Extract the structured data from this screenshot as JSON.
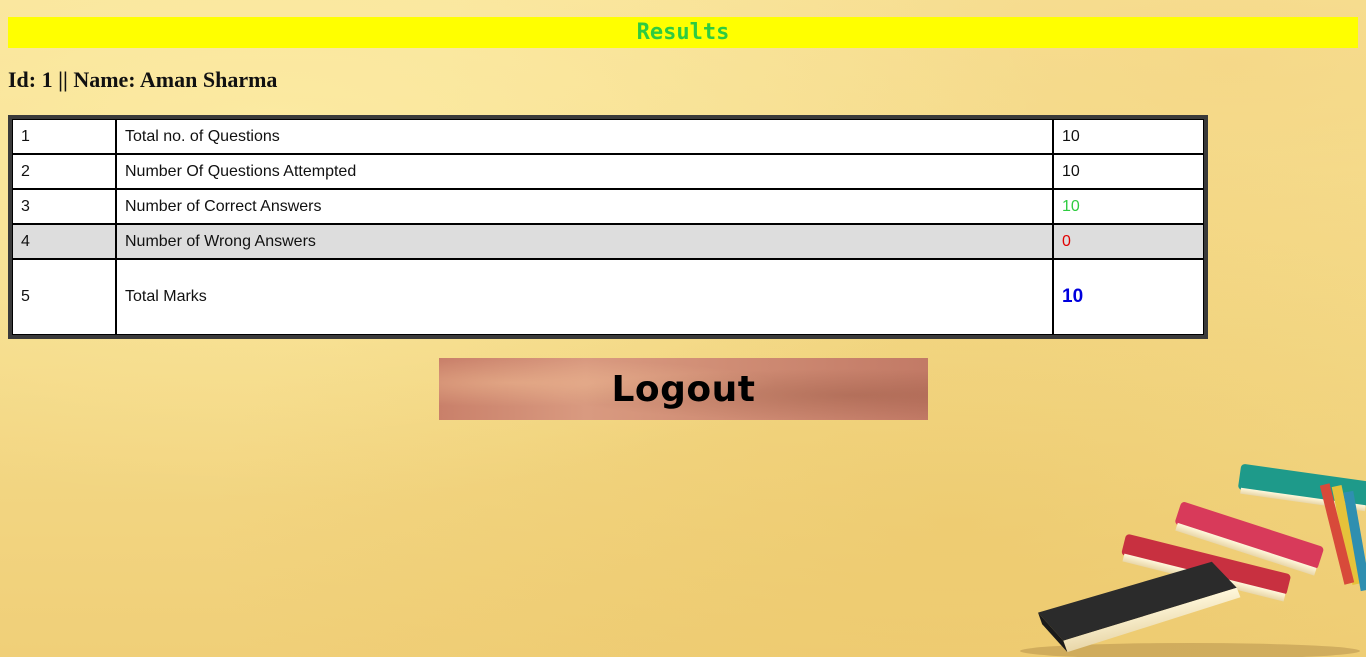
{
  "header": {
    "title": "Results"
  },
  "user": {
    "line": "Id: 1 || Name: Aman Sharma"
  },
  "results": {
    "rows": [
      {
        "num": "1",
        "label": "Total no. of Questions",
        "value": "10"
      },
      {
        "num": "2",
        "label": "Number Of Questions Attempted",
        "value": "10"
      },
      {
        "num": "3",
        "label": "Number of Correct Answers",
        "value": "10"
      },
      {
        "num": "4",
        "label": "Number of Wrong Answers",
        "value": "0"
      },
      {
        "num": "5",
        "label": "Total Marks",
        "value": "10"
      }
    ]
  },
  "actions": {
    "logout_label": "Logout"
  },
  "colors": {
    "header_bg": "#ffff00",
    "header_text": "#2ecc40",
    "correct": "#2ecc40",
    "wrong": "#e00000",
    "total": "#0000dd"
  },
  "decor": {
    "icon": "stacked-books-illustration"
  }
}
